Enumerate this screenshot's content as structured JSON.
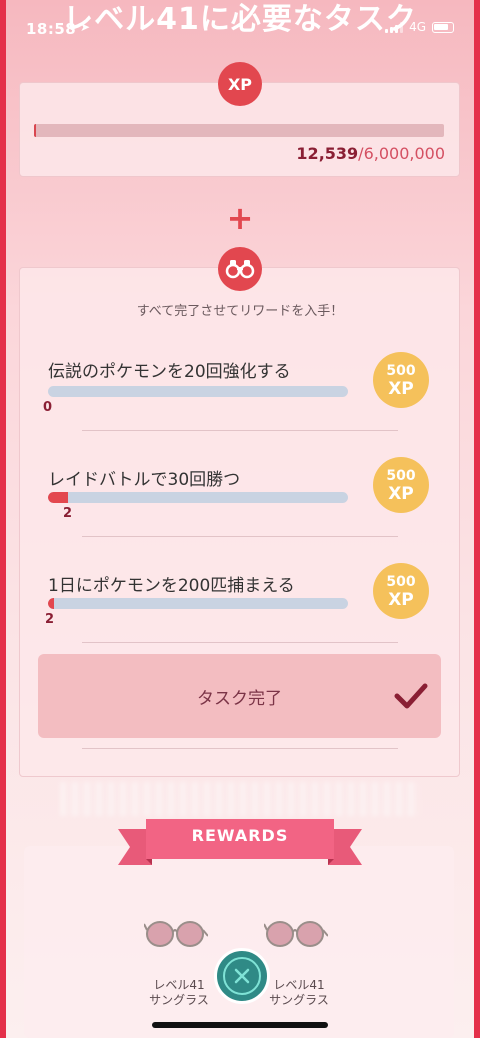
{
  "status_bar": {
    "time": "18:58",
    "network": "4G"
  },
  "title": "レベル41に必要なタスク",
  "xp": {
    "badge_label": "XP",
    "current": "12,539",
    "total": "/6,000,000",
    "progress_fraction": 0.0021
  },
  "tasks": {
    "hint": "すべて完了させてリワードを入手！",
    "items": [
      {
        "label": "伝説のポケモンを20回強化する",
        "progress": "0",
        "fraction": 0.0,
        "reward_amount": "500",
        "reward_unit": "XP"
      },
      {
        "label": "レイドバトルで30回勝つ",
        "progress": "2",
        "fraction": 0.067,
        "reward_amount": "500",
        "reward_unit": "XP"
      },
      {
        "label": "1日にポケモンを200匹捕まえる",
        "progress": "2",
        "fraction": 0.01,
        "reward_amount": "500",
        "reward_unit": "XP"
      }
    ],
    "complete_button_label": "タスク完了"
  },
  "rewards": {
    "banner_label": "REWARDS",
    "items": [
      {
        "line1": "レベル41",
        "line2": "サングラス"
      },
      {
        "line1": "レベル41",
        "line2": "サングラス"
      }
    ]
  },
  "colors": {
    "accent_red": "#e2474f",
    "coin_gold": "#f5c15b",
    "close_teal": "#2f8a86"
  }
}
